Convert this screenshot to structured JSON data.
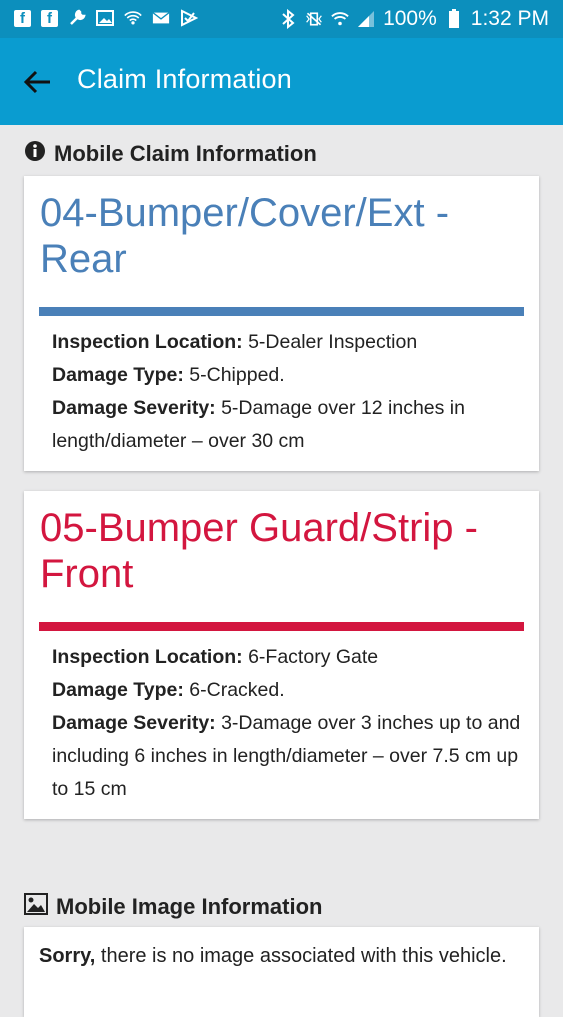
{
  "status_bar": {
    "battery_percent": "100%",
    "time": "1:32 PM",
    "icons": [
      "facebook-icon",
      "facebook-icon",
      "wrench-icon",
      "image-icon",
      "wifi-icon",
      "mail-icon",
      "check-icon",
      "bluetooth-icon",
      "vibrate-icon",
      "wifi-icon",
      "signal-icon",
      "battery-icon"
    ]
  },
  "app_bar": {
    "title": "Claim Information",
    "color": "#0a9cd0"
  },
  "claim_section": {
    "heading": "Mobile Claim Information"
  },
  "claims": [
    {
      "title": "04-Bumper/Cover/Ext - Rear",
      "color": "#4a80b8",
      "inspection_location_label": "Inspection Location:",
      "inspection_location": " 5-Dealer Inspection",
      "damage_type_label": "Damage Type:",
      "damage_type": " 5-Chipped.",
      "damage_severity_label": "Damage Severity:",
      "damage_severity": " 5-Damage over 12 inches in length/diameter – over 30 cm"
    },
    {
      "title": "05-Bumper Guard/Strip - Front",
      "color": "#d3163f",
      "inspection_location_label": "Inspection Location:",
      "inspection_location": " 6-Factory Gate",
      "damage_type_label": "Damage Type:",
      "damage_type": " 6-Cracked.",
      "damage_severity_label": "Damage Severity:",
      "damage_severity": " 3-Damage over 3 inches up to and including 6 inches in length/diameter – over 7.5 cm up to 15 cm"
    }
  ],
  "image_section": {
    "heading": "Mobile Image Information",
    "message_bold": "Sorry,",
    "message": " there is no image associated with this vehicle."
  }
}
